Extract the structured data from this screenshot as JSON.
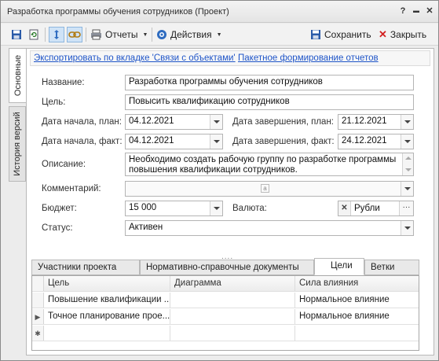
{
  "window": {
    "title": "Разработка программы обучения сотрудников (Проект)",
    "help_label": "?",
    "minimize_label": "▬",
    "maximize_label": "□",
    "close_label": "✕"
  },
  "toolbar": {
    "reports_label": "Отчеты",
    "actions_label": "Действия",
    "save_label": "Сохранить",
    "close_label": "Закрыть"
  },
  "side_tabs": {
    "main": "Основные",
    "history": "История версий"
  },
  "links": {
    "export": "Экспортировать по вкладке 'Связи с объектами'",
    "batch": "Пакетное формирование отчетов"
  },
  "form": {
    "name_label": "Название:",
    "name_value": "Разработка программы обучения сотрудников",
    "goal_label": "Цель:",
    "goal_value": "Повысить квалификацию сотрудников",
    "start_plan_label": "Дата начала, план:",
    "start_plan_value": "04.12.2021",
    "end_plan_label": "Дата завершения, план:",
    "end_plan_value": "21.12.2021",
    "start_fact_label": "Дата начала, факт:",
    "start_fact_value": "04.12.2021",
    "end_fact_label": "Дата завершения, факт:",
    "end_fact_value": "24.12.2021",
    "description_label": "Описание:",
    "description_value": "Необходимо создать рабочую группу по разработке программы повышения квалификации сотрудников.",
    "comment_label": "Комментарий:",
    "comment_value": "",
    "budget_label": "Бюджет:",
    "budget_value": "15 000",
    "currency_label": "Валюта:",
    "currency_value": "Рубли",
    "currency_clear": "✕",
    "currency_more": "···",
    "status_label": "Статус:",
    "status_value": "Активен"
  },
  "splitter_label": "....",
  "tabs": [
    "Участники проекта",
    "Нормативно-справочные документы",
    "Цели",
    "Ветки"
  ],
  "grid": {
    "headers": [
      "Цель",
      "Диаграмма",
      "Сила влияния"
    ],
    "rows": [
      [
        "Повышение квалификации ...",
        "",
        "Нормальное влияние"
      ],
      [
        "Точное планирование прое...",
        "",
        "Нормальное влияние"
      ]
    ],
    "current_row_marker": "▶",
    "new_row_marker": "✱"
  },
  "colors": {
    "link": "#1f55c8",
    "save_icon": "#2a5aa8",
    "close_icon": "#d22020",
    "active_toolbar": "#cfe3f7"
  }
}
